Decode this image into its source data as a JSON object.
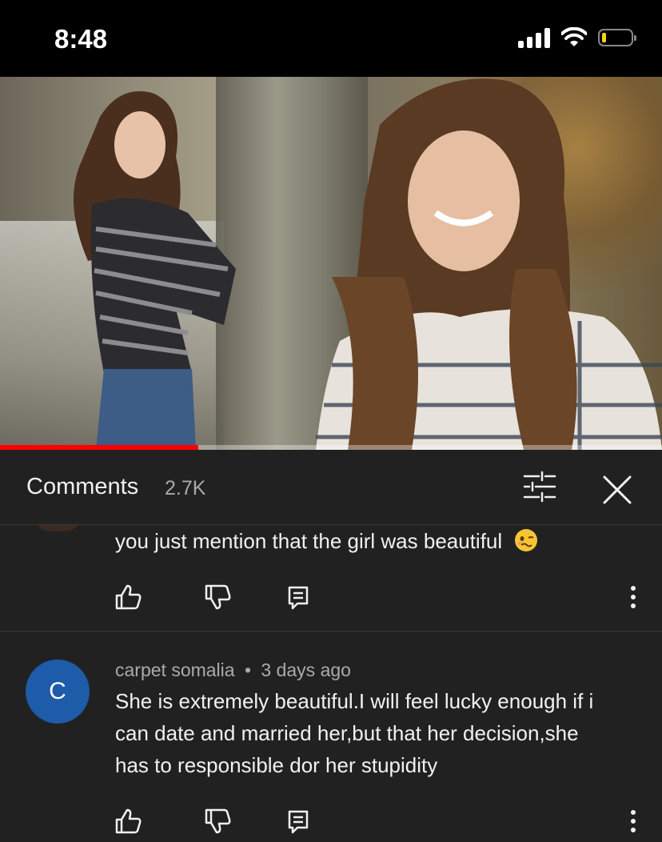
{
  "status_bar": {
    "time": "8:48",
    "battery_level": 0.15,
    "battery_color": "#f3d31a"
  },
  "video": {
    "progress": 0.3,
    "progress_color": "#ff0000",
    "thumbnail": "two portraits of a young woman with long hair outdoors by a tree"
  },
  "comments_panel": {
    "title": "Comments",
    "count": "2.7K",
    "filter_icon": "sliders-icon",
    "close_icon": "close-icon"
  },
  "comments": [
    {
      "text": "you just mention that the girl was beautiful",
      "emoji": "woozy-face-emoji"
    },
    {
      "avatar_letter": "C",
      "avatar_color": "#1e5ba8",
      "author": "carpet somalia",
      "separator": "•",
      "time": "3 days ago",
      "text_lines": [
        "She is extremely beautiful.I will feel lucky enough if i",
        "can date and married her,but that her decision,she",
        "has to responsible dor her stupidity"
      ]
    }
  ],
  "actions": {
    "like": "thumbs-up-icon",
    "dislike": "thumbs-down-icon",
    "reply": "reply-icon",
    "more": "more-vertical-icon"
  }
}
